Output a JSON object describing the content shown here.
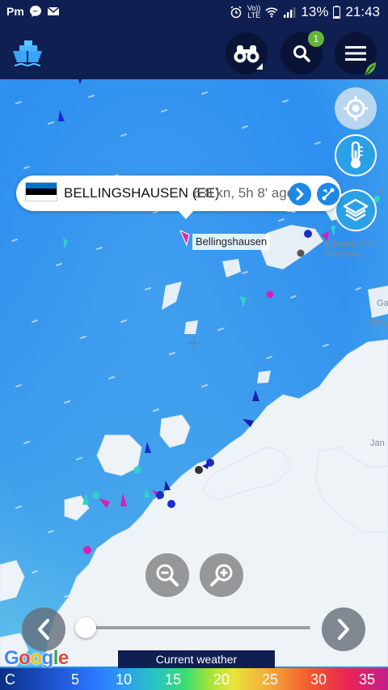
{
  "status_bar": {
    "app_indicator": "Pm",
    "volte": "Vo))",
    "lte": "LTE",
    "battery": "13%",
    "time": "21:43"
  },
  "header": {
    "logo": "vessel-logo-icon",
    "notification_count": "1"
  },
  "popup": {
    "flag_colors": [
      "#0072ce",
      "#000000",
      "#ffffff"
    ],
    "vessel_name": "BELLINGSHAUSEN (EE)",
    "info": "6.8 kn, 5h 8' ago"
  },
  "map": {
    "vessel_label": "Bellingshausen",
    "place_labels": [
      "Eduardo Frei",
      "Montalva",
      "Jan",
      "B",
      "O'Hig",
      "Ga"
    ]
  },
  "weather": {
    "label": "Current weather",
    "scale_labels": [
      "C",
      "5",
      "10",
      "15",
      "20",
      "25",
      "30",
      "35"
    ]
  },
  "attribution": {
    "google": [
      "G",
      "o",
      "o",
      "g",
      "l",
      "e"
    ]
  },
  "colors": {
    "header_bg": "#0f1f52",
    "accent_blue": "#1e88e5",
    "badge_green": "#63b33b"
  }
}
